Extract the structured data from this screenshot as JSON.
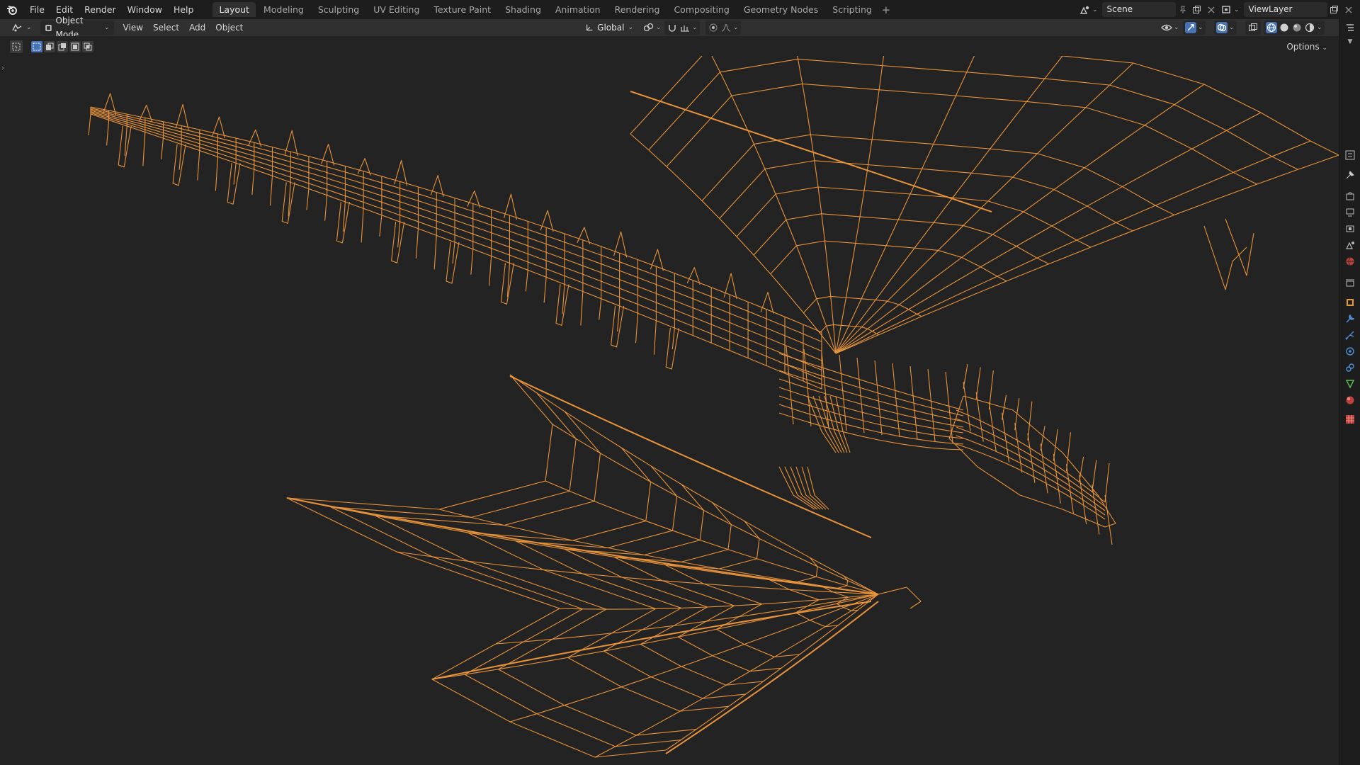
{
  "menu": [
    "File",
    "Edit",
    "Render",
    "Window",
    "Help"
  ],
  "workspaces": [
    "Layout",
    "Modeling",
    "Sculpting",
    "UV Editing",
    "Texture Paint",
    "Shading",
    "Animation",
    "Rendering",
    "Compositing",
    "Geometry Nodes",
    "Scripting"
  ],
  "active_workspace": "Layout",
  "scene": {
    "name": "Scene"
  },
  "view_layer": {
    "name": "ViewLayer"
  },
  "header": {
    "mode": "Object Mode",
    "view": "View",
    "select": "Select",
    "add": "Add",
    "object": "Object",
    "orientation": "Global"
  },
  "viewport": {
    "options_label": "Options",
    "overlay_wire_color": "#e8933a",
    "background": "#232323"
  },
  "colors": {
    "accent": "#4772b3",
    "wire": "#e8933a"
  }
}
